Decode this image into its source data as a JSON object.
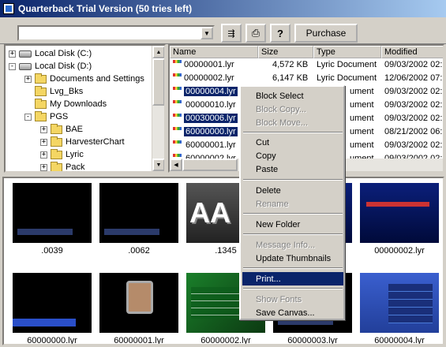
{
  "window": {
    "title": "Quarterback Trial Version (50 tries left)"
  },
  "toolbar": {
    "path_value": "",
    "purchase_label": "Purchase",
    "help_glyph": "?"
  },
  "tree": {
    "items": [
      {
        "label": "Local Disk (C:)",
        "expander": "+"
      },
      {
        "label": "Local Disk (D:)",
        "expander": "-"
      },
      {
        "label": "Documents and Settings",
        "expander": "+"
      },
      {
        "label": "Lvg_Bks",
        "expander": ""
      },
      {
        "label": "My Downloads",
        "expander": ""
      },
      {
        "label": "PGS",
        "expander": "-"
      },
      {
        "label": "BAE",
        "expander": "+"
      },
      {
        "label": "HarvesterChart",
        "expander": "+"
      },
      {
        "label": "Lyric",
        "expander": "+"
      },
      {
        "label": "Pack",
        "expander": "+"
      }
    ]
  },
  "filelist": {
    "columns": [
      "Name",
      "Size",
      "Type",
      "Modified"
    ],
    "rows": [
      {
        "name": "00000001.lyr",
        "size": "4,572 KB",
        "type": "Lyric Document",
        "modified": "09/03/2002 02:"
      },
      {
        "name": "00000002.lyr",
        "size": "6,147 KB",
        "type": "Lyric Document",
        "modified": "12/06/2002 07:"
      },
      {
        "name": "00000004.lyr",
        "size": "",
        "type": "ument",
        "modified": "09/03/2002 02:"
      },
      {
        "name": "00000010.lyr",
        "size": "",
        "type": "ument",
        "modified": "09/03/2002 02:"
      },
      {
        "name": "00030006.lyr",
        "size": "",
        "type": "ument",
        "modified": "09/03/2002 02:"
      },
      {
        "name": "60000000.lyr",
        "size": "",
        "type": "ument",
        "modified": "08/21/2002 06:"
      },
      {
        "name": "60000001.lyr",
        "size": "",
        "type": "ument",
        "modified": "09/03/2002 02:"
      },
      {
        "name": "60000002.lyr",
        "size": "",
        "type": "ument",
        "modified": "09/03/2002 02:"
      }
    ]
  },
  "thumbnails": [
    {
      "caption": ".0039"
    },
    {
      "caption": ".0062"
    },
    {
      "caption": ".1345"
    },
    {
      "caption": ""
    },
    {
      "caption": "00000002.lyr"
    },
    {
      "caption": "60000000.lyr"
    },
    {
      "caption": "60000001.lyr"
    },
    {
      "caption": "60000002.lyr"
    },
    {
      "caption": "60000003.lyr"
    },
    {
      "caption": "60000004.lyr"
    }
  ],
  "thumb_text": {
    "aa": "AA"
  },
  "context_menu": {
    "items": [
      {
        "label": "Block Select",
        "enabled": true
      },
      {
        "label": "Block Copy...",
        "enabled": false
      },
      {
        "label": "Block Move...",
        "enabled": false
      },
      {
        "label": "Cut",
        "enabled": true
      },
      {
        "label": "Copy",
        "enabled": true
      },
      {
        "label": "Paste",
        "enabled": true
      },
      {
        "label": "Delete",
        "enabled": true
      },
      {
        "label": "Rename",
        "enabled": false
      },
      {
        "label": "New Folder",
        "enabled": true
      },
      {
        "label": "Message Info...",
        "enabled": false
      },
      {
        "label": "Update Thumbnails",
        "enabled": true
      },
      {
        "label": "Print...",
        "enabled": true,
        "highlighted": true
      },
      {
        "label": "Show Fonts",
        "enabled": false
      },
      {
        "label": "Save Canvas...",
        "enabled": true
      }
    ]
  },
  "colors": {
    "selection": "#0a246a",
    "title_start": "#0a246a",
    "title_end": "#a6caf0",
    "face": "#d4d0c8"
  }
}
